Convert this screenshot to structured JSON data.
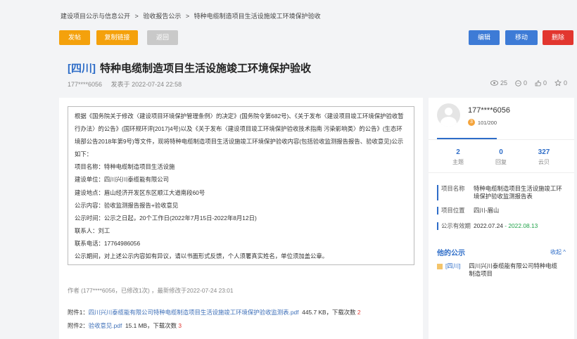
{
  "breadcrumb": [
    "建设项目公示与信息公开",
    ">",
    "验收报告公示",
    ">",
    "特种电缆制造项目生活设施竣工环境保护验收"
  ],
  "toolbar": {
    "post": "发帖",
    "copy_link": "复制链接",
    "back": "返回",
    "edit": "编辑",
    "move": "移动",
    "delete": "删除"
  },
  "post": {
    "tag": "[四川]",
    "title": "特种电缆制造项目生活设施竣工环境保护验收",
    "author": "177****6056",
    "posted": "发表于 2022-07-24 22:58",
    "views": "25",
    "comments": "0",
    "likes": "0",
    "favorites": "0"
  },
  "notice": {
    "intro": "根据《国务院关于修改〈建设项目环境保护管理条例〉的决定》(国务院令第682号)、《关于发布〈建设项目竣工环境保护验收暂行办法〉的公告》(国环规环评[2017]4号)以及《关于发布〈建设项目竣工环境保护验收技术指南 污染影响类〉的公告》(生态环境部公告2018年第9号)等文件，现将特种电缆制造项目生活设施竣工环境保护验收内容(包括验收监测报告报告、验收意见)公示如下：",
    "project_name": "项目名称：特种电缆制造项目生活设施",
    "unit": "建设单位：四川兴川泰缆能有限公司",
    "location": "建设地点：眉山经济开发区东区顺江大道南段60号",
    "content": "公示内容：验收监测报告报告+验收意见",
    "period": "公示时间：公示之日起，20个工作日(2022年7月15日-2022年8月12日)",
    "contact": "联系人：刘工",
    "phone": "联系电话：17764986056",
    "remark": "公示期间，对上述公示内容如有异议，请以书面形式反馈，个人须署真实姓名，单位须加盖公章。"
  },
  "edit_info": "作者 (177****6056，已修改1次) ，最新修改于2022-07-24 23:01",
  "attachments": [
    {
      "prefix": "附件1：",
      "name": "四川兴川泰缆能有限公司特种电缆制造项目生活设施竣工环境保护验收监测表.pdf",
      "size": "445.7 KB",
      "dl_label": "，下载次数",
      "dl": "2"
    },
    {
      "prefix": "附件2：",
      "name": "验收意见.pdf",
      "size": "15.1 MB",
      "dl_label": "，下载次数",
      "dl": "3"
    }
  ],
  "sidebar": {
    "username": "177****6056",
    "level_badge": "3",
    "level": "101/200",
    "stats": [
      {
        "n": "2",
        "l": "主题"
      },
      {
        "n": "0",
        "l": "回复"
      },
      {
        "n": "327",
        "l": "云贝"
      }
    ],
    "info": [
      {
        "k": "项目名称",
        "v": "特种电缆制造项目生活设施竣工环境保护验收监测报告表"
      },
      {
        "k": "项目位置",
        "v": "四川-眉山"
      },
      {
        "k": "公示有效期",
        "v": "2022.07.24",
        "v2": "- 2022.08.13"
      }
    ],
    "other_title": "他的公示",
    "collapse": "收起 ^",
    "other_items": [
      {
        "tag": "[四川]",
        "text": "四川兴川泰缆能有限公司特种电缆制造项目"
      }
    ]
  },
  "colors": {
    "accent": "#2e6dc8",
    "orange": "#f4a10c",
    "danger": "#e2362f",
    "green": "#21a34a"
  }
}
